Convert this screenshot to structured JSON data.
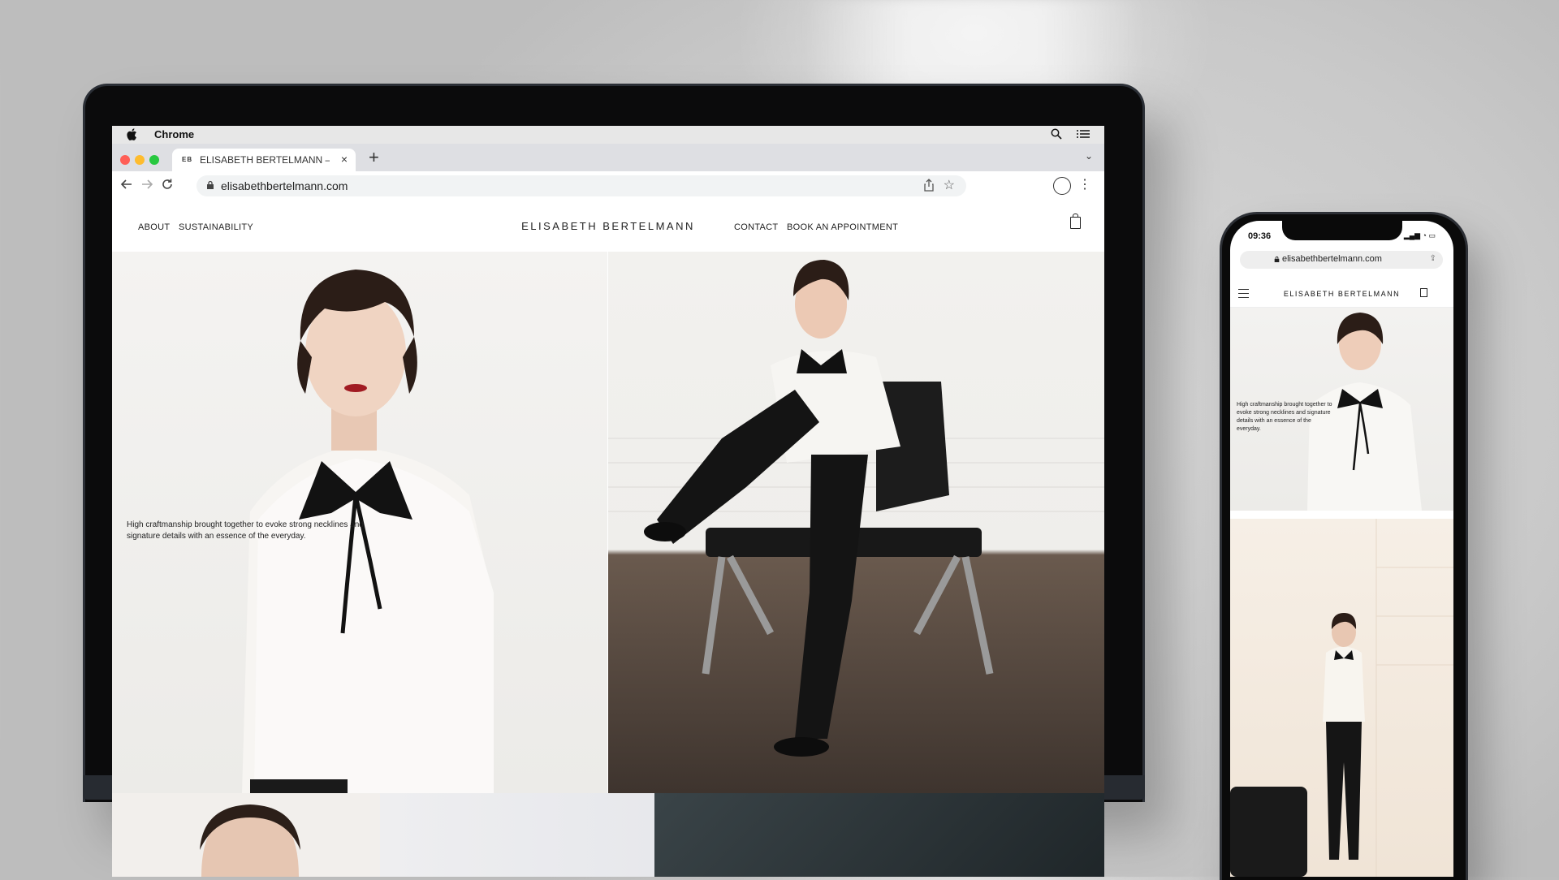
{
  "mac_menubar": {
    "app_name": "Chrome"
  },
  "browser": {
    "tab": {
      "favicon_text": "EB",
      "title": "ELISABETH BERTELMANN – OFFICIAL WEBSITE",
      "close": "×"
    },
    "new_tab": "+",
    "tab_menu": "⌄",
    "url": "elisabethbertelmann.com"
  },
  "site": {
    "brand": "ELISABETH BERTELMANN",
    "nav_left": [
      "ABOUT",
      "SUSTAINABILITY"
    ],
    "nav_right": [
      "CONTACT",
      "BOOK AN APPOINTMENT"
    ],
    "hero_text": "High craftmanship brought together to evoke strong necklines and signature details with an essence of the everyday."
  },
  "phone": {
    "time": "09:36",
    "url": "elisabethbertelmann.com",
    "brand": "ELISABETH BERTELMANN",
    "hero_text": "High craftmanship brought together to evoke strong necklines and signature details with an essence of the everyday."
  },
  "icons": [
    "apple-icon",
    "search-icon",
    "menu-list-icon",
    "lock-icon",
    "share-icon",
    "star-icon",
    "profile-icon",
    "more-icon",
    "back-arrow-icon",
    "forward-arrow-icon",
    "reload-icon",
    "bag-icon",
    "hamburger-icon"
  ]
}
